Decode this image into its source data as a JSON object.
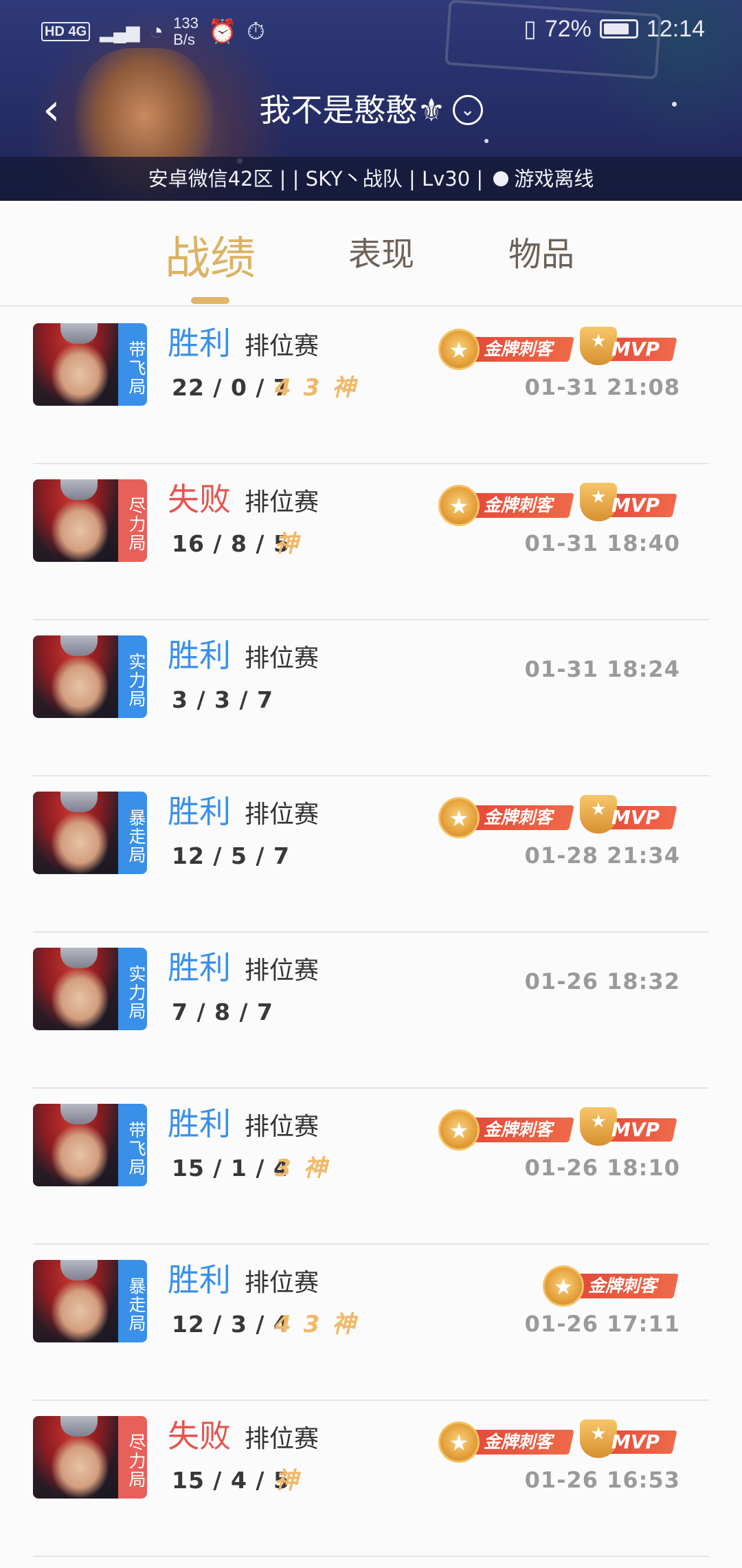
{
  "status_bar": {
    "network": "HD 4G",
    "speed": [
      "133",
      "B/s"
    ],
    "battery": "72%",
    "time": "12:14"
  },
  "header": {
    "title": "我不是憨憨⚜",
    "info_left": "安卓微信42区 |  | SKY丶战队 | Lv30 | ",
    "info_status": "游戏离线"
  },
  "tabs": [
    {
      "label": "战绩",
      "active": true
    },
    {
      "label": "表现",
      "active": false
    },
    {
      "label": "物品",
      "active": false
    }
  ],
  "badge_labels": {
    "gold": "金牌刺客",
    "mvp": "MVP"
  },
  "colors": {
    "win": "#3990ea",
    "lose": "#e8544e",
    "accent": "#dcb263"
  },
  "matches": [
    {
      "tag": "带飞局",
      "tag_color": "blue",
      "result": "胜利",
      "win": true,
      "mode": "排位赛",
      "kda": "22 / 0 / 7",
      "streaks": [
        "4",
        "3",
        "神"
      ],
      "gold": true,
      "mvp": true,
      "time": "01-31 21:08"
    },
    {
      "tag": "尽力局",
      "tag_color": "red",
      "result": "失败",
      "win": false,
      "mode": "排位赛",
      "kda": "16 / 8 / 5",
      "streaks": [
        "神"
      ],
      "gold": true,
      "mvp": true,
      "time": "01-31 18:40"
    },
    {
      "tag": "实力局",
      "tag_color": "blue",
      "result": "胜利",
      "win": true,
      "mode": "排位赛",
      "kda": "3 / 3 / 7",
      "streaks": [],
      "gold": false,
      "mvp": false,
      "time": "01-31 18:24"
    },
    {
      "tag": "暴走局",
      "tag_color": "blue",
      "result": "胜利",
      "win": true,
      "mode": "排位赛",
      "kda": "12 / 5 / 7",
      "streaks": [],
      "gold": true,
      "mvp": true,
      "time": "01-28 21:34"
    },
    {
      "tag": "实力局",
      "tag_color": "blue",
      "result": "胜利",
      "win": true,
      "mode": "排位赛",
      "kda": "7 / 8 / 7",
      "streaks": [],
      "gold": false,
      "mvp": false,
      "time": "01-26 18:32"
    },
    {
      "tag": "带飞局",
      "tag_color": "blue",
      "result": "胜利",
      "win": true,
      "mode": "排位赛",
      "kda": "15 / 1 / 4",
      "streaks": [
        "3",
        "神"
      ],
      "gold": true,
      "mvp": true,
      "time": "01-26 18:10"
    },
    {
      "tag": "暴走局",
      "tag_color": "blue",
      "result": "胜利",
      "win": true,
      "mode": "排位赛",
      "kda": "12 / 3 / 4",
      "streaks": [
        "4",
        "3",
        "神"
      ],
      "gold": true,
      "mvp": false,
      "time": "01-26 17:11"
    },
    {
      "tag": "尽力局",
      "tag_color": "red",
      "result": "失败",
      "win": false,
      "mode": "排位赛",
      "kda": "15 / 4 / 5",
      "streaks": [
        "神"
      ],
      "gold": true,
      "mvp": true,
      "time": "01-26 16:53"
    }
  ]
}
